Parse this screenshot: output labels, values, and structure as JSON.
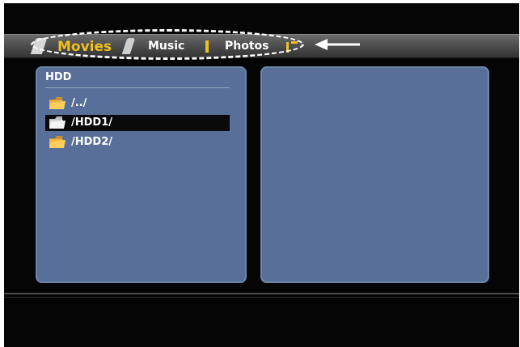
{
  "tabs": {
    "items": [
      {
        "label": "Movies",
        "active": true
      },
      {
        "label": "Music",
        "active": false
      },
      {
        "label": "Photos",
        "active": false
      }
    ]
  },
  "left_panel": {
    "title": "HDD",
    "entries": [
      {
        "label": "/../",
        "icon": "folder-icon",
        "selected": false
      },
      {
        "label": "/HDD1/",
        "icon": "folder-icon",
        "selected": true
      },
      {
        "label": "/HDD2/",
        "icon": "folder-icon",
        "selected": false
      }
    ]
  },
  "right_panel": {
    "content": ""
  },
  "colors": {
    "background": "#050505",
    "panel": "#587099",
    "active_tab": "#f0c01e",
    "tab_text": "#ffffff",
    "selection": "#0a0a0a"
  },
  "annotations": {
    "highlight": "dashed-oval",
    "pointer": "arrow-left"
  }
}
